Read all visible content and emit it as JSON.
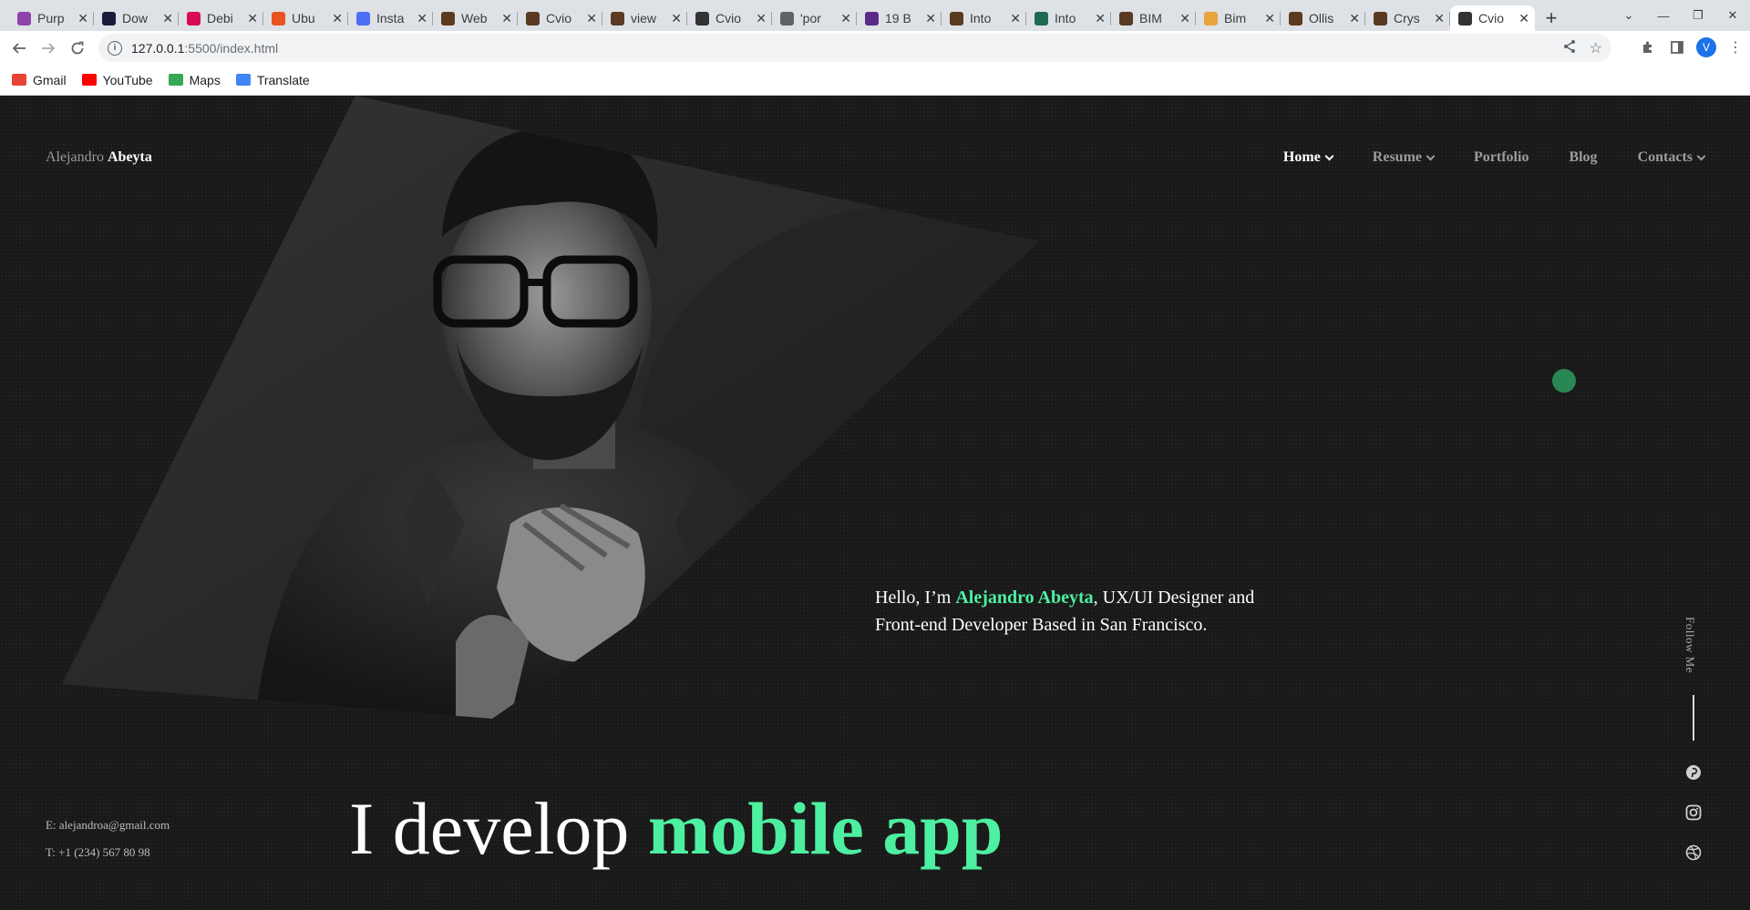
{
  "browser": {
    "tabs": [
      {
        "title": "Purp",
        "color": "#8e44ad"
      },
      {
        "title": "Dow",
        "color": "#1a1a3a"
      },
      {
        "title": "Debi",
        "color": "#d70a53"
      },
      {
        "title": "Ubu",
        "color": "#e95420"
      },
      {
        "title": "Insta",
        "color": "#4c6ef5"
      },
      {
        "title": "Web",
        "color": "#5a3a20"
      },
      {
        "title": "Cvio",
        "color": "#5a3a20"
      },
      {
        "title": "view",
        "color": "#5a3a20"
      },
      {
        "title": "Cvio",
        "color": "#333333"
      },
      {
        "title": "'por",
        "color": "#5f6368"
      },
      {
        "title": "19 B",
        "color": "#5b2a86"
      },
      {
        "title": "Into",
        "color": "#5a3a20"
      },
      {
        "title": "Into",
        "color": "#1e6b52"
      },
      {
        "title": "BIM",
        "color": "#5a3a20"
      },
      {
        "title": "Bim",
        "color": "#e8a33d"
      },
      {
        "title": "Ollis",
        "color": "#5a3a20"
      },
      {
        "title": "Crys",
        "color": "#5a3a20"
      },
      {
        "title": "Cvio",
        "color": "#333333",
        "active": true
      }
    ],
    "new_tab_label": "+",
    "url_host": "127.0.0.1",
    "url_path": ":5500/index.html",
    "profile_initial": "V",
    "bookmarks": [
      {
        "label": "Gmail",
        "color": "#ea4335"
      },
      {
        "label": "YouTube",
        "color": "#ff0000"
      },
      {
        "label": "Maps",
        "color": "#34a853"
      },
      {
        "label": "Translate",
        "color": "#4285f4"
      }
    ]
  },
  "site": {
    "logo_first": "Alejandro",
    "logo_last": "Abeyta",
    "nav": [
      {
        "label": "Home",
        "dropdown": true,
        "active": true
      },
      {
        "label": "Resume",
        "dropdown": true
      },
      {
        "label": "Portfolio",
        "dropdown": false
      },
      {
        "label": "Blog",
        "dropdown": false
      },
      {
        "label": "Contacts",
        "dropdown": true
      }
    ],
    "intro_prefix": "Hello, I’m ",
    "intro_name": "Alejandro Abeyta",
    "intro_suffix": ", UX/UI Designer and Front-end Developer Based in San Francisco.",
    "headline_prefix": "I develop ",
    "headline_highlight": "mobile app",
    "email_line": "E: alejandroa@gmail.com",
    "phone_line": "T: +1 (234) 567 80 98",
    "follow_label": "Follow Me",
    "socials": [
      {
        "icon": "pinterest-icon"
      },
      {
        "icon": "instagram-icon"
      },
      {
        "icon": "dribbble-icon"
      }
    ],
    "accent_color": "#4df0a0"
  }
}
